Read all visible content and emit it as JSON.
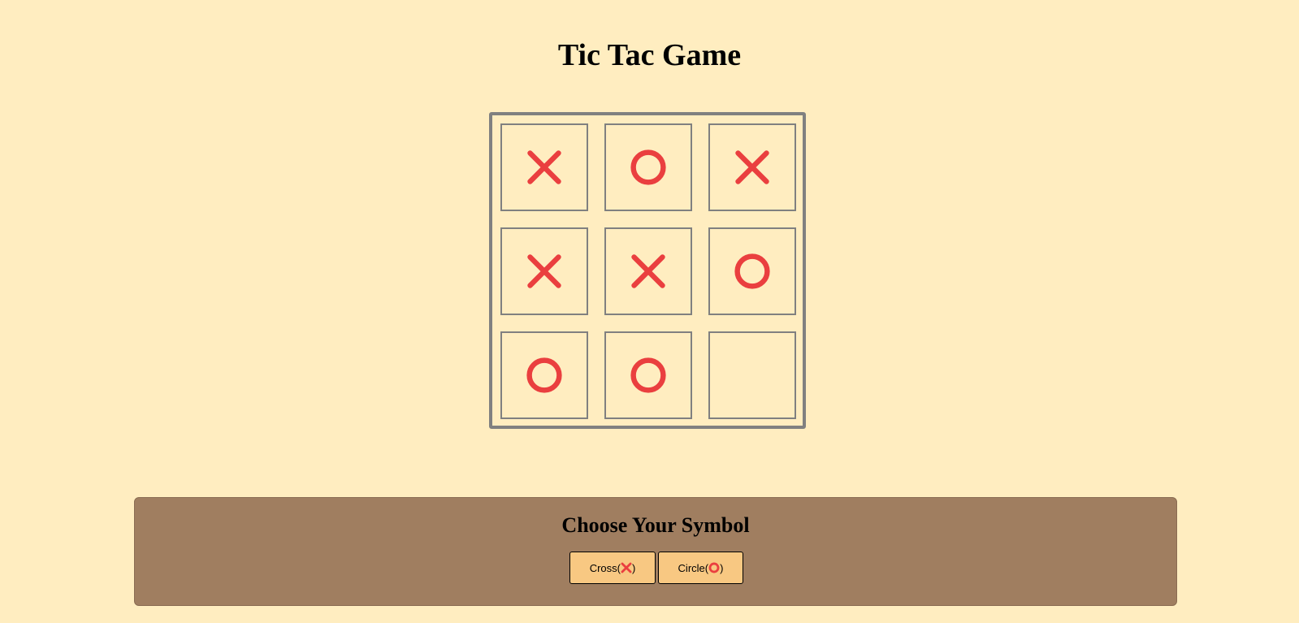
{
  "page": {
    "title": "Tic Tac Game"
  },
  "board": {
    "cells": [
      "X",
      "O",
      "X",
      "X",
      "X",
      "O",
      "O",
      "O",
      ""
    ]
  },
  "chooser": {
    "heading": "Choose Your Symbol",
    "cross_label": "Cross(",
    "circle_label": "Circle(",
    "label_close": ")"
  },
  "colors": {
    "background": "#ffedc0",
    "board_border": "#808080",
    "mark": "#ea3f3f",
    "panel": "#a07e60",
    "button": "#f8c882"
  },
  "icons": {
    "cross": "cross-mark-icon",
    "circle": "circle-mark-icon"
  }
}
